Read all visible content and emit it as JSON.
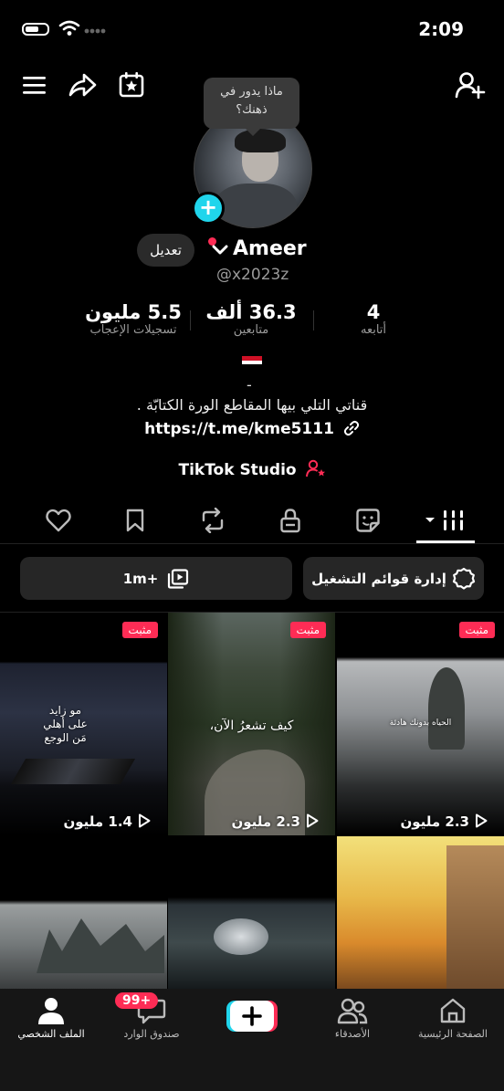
{
  "status_bar": {
    "time": "2:09"
  },
  "bubble": {
    "line1": "ماذا يدور في",
    "line2": "ذهنك؟"
  },
  "profile": {
    "edit_label": "تعديل",
    "name": "Ameer",
    "handle": "@x2023z"
  },
  "stats": [
    {
      "value": "5.5 مليون",
      "label": "تسجيلات الإعجاب"
    },
    {
      "value": "36.3 ألف",
      "label": "متابعين"
    },
    {
      "value": "4",
      "label": "أتابعه"
    }
  ],
  "bio": {
    "dash": "-",
    "text": "قناتي التلي بيها المقاطع الورة الكتابّة .",
    "link": "https://t.me/kme5111",
    "studio": "TikTok Studio"
  },
  "actions": {
    "playlist_label": "إدارة قوائم التشغيل",
    "count_label": "1m+"
  },
  "videos": [
    {
      "pinned": "مثبت",
      "views": "1.4 مليون",
      "caption": "مو زايد\nعلى أهلي\nمَن الوجع"
    },
    {
      "pinned": "مثبت",
      "views": "2.3 مليون",
      "caption": "كيف تشعرُ الآن،"
    },
    {
      "pinned": "مثبت",
      "views": "2.3 مليون",
      "caption": "الحياه بدونك هادئة"
    },
    {
      "caption": ""
    },
    {
      "caption": ""
    },
    {
      "caption": ""
    }
  ],
  "nav": {
    "home": "الصفحة الرئيسية",
    "friends": "الأصدقاء",
    "inbox": "صندوق الوارد",
    "inbox_badge": "99+",
    "profile": "الملف الشخصي"
  },
  "colors": {
    "accent": "#fe2c55",
    "cyan": "#20d5ec",
    "background": "#000000"
  }
}
